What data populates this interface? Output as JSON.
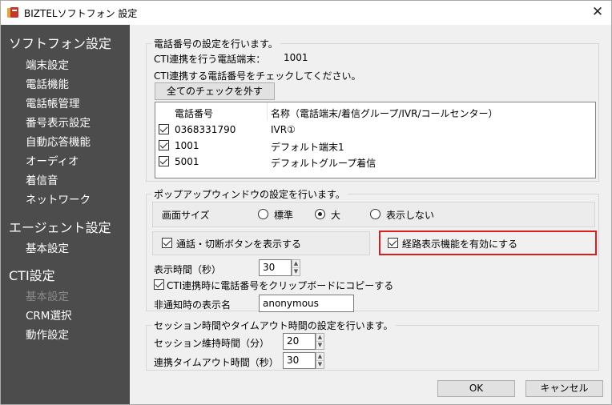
{
  "window": {
    "title": "BIZTELソフトフォン 設定",
    "close_glyph": "✕"
  },
  "sidebar": {
    "sections": [
      {
        "label": "ソフトフォン設定",
        "items": [
          "端末設定",
          "電話機能",
          "電話帳管理",
          "番号表示設定",
          "自動応答機能",
          "オーディオ",
          "着信音",
          "ネットワーク"
        ]
      },
      {
        "label": "エージェント設定",
        "items": [
          "基本設定"
        ]
      },
      {
        "label": "CTI設定",
        "items": [
          "基本設定",
          "CRM選択",
          "動作設定"
        ]
      }
    ],
    "disabled_item": "基本設定"
  },
  "phone_group": {
    "legend": "電話番号の設定を行います。",
    "cti_terminal_label": "CTI連携を行う電話端末：",
    "cti_terminal_value": "1001",
    "instruction": "CTI連携する電話番号をチェックしてください。",
    "uncheck_all_button": "全てのチェックを外す",
    "columns": [
      "電話番号",
      "名称（電話端末/着信グループ/IVR/コールセンター）"
    ],
    "rows": [
      {
        "number": "0368331790",
        "name": "IVR①",
        "checked": true
      },
      {
        "number": "1001",
        "name": "デフォルト端末1",
        "checked": true
      },
      {
        "number": "5001",
        "name": "デフォルトグループ着信",
        "checked": true
      }
    ]
  },
  "popup_group": {
    "legend": "ポップアップウィンドウの設定を行います。",
    "screen_size_label": "画面サイズ",
    "screen_size_options": [
      "標準",
      "大",
      "表示しない"
    ],
    "screen_size_selected": "大",
    "show_call_button_label": "通話・切断ボタンを表示する",
    "show_call_button_checked": true,
    "route_display_label": "経路表示機能を有効にする",
    "route_display_checked": true,
    "display_time_label": "表示時間（秒）",
    "display_time_value": "30",
    "copy_clipboard_label": "CTI連携時に電話番号をクリップボードにコピーする",
    "copy_clipboard_checked": true,
    "anonymous_label": "非通知時の表示名",
    "anonymous_value": "anonymous"
  },
  "session_group": {
    "legend": "セッション時間やタイムアウト時間の設定を行います。",
    "session_keep_label": "セッション維持時間（分）",
    "session_keep_value": "20",
    "link_timeout_label": "連携タイムアウト時間（秒）",
    "link_timeout_value": "30"
  },
  "footer": {
    "ok_label": "OK",
    "cancel_label": "キャンセル"
  },
  "colors": {
    "sidebar_bg": "#4c4c4c",
    "highlight": "#d81e1e"
  }
}
